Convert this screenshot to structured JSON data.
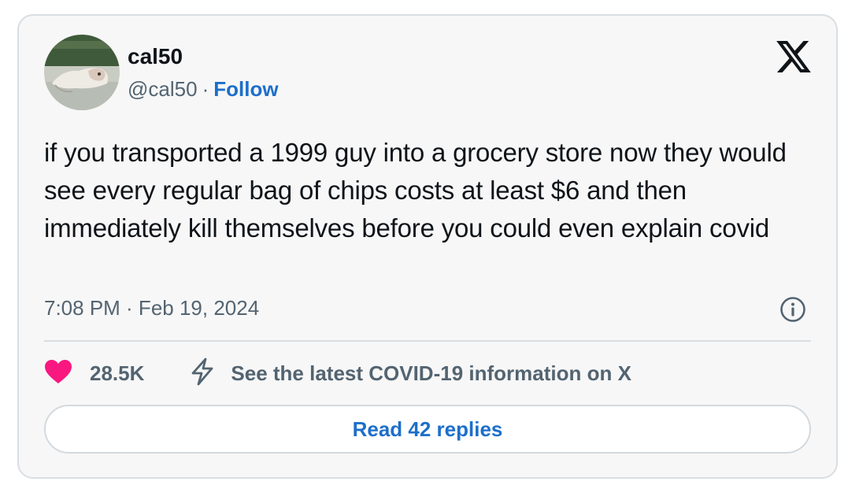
{
  "author": {
    "display_name": "cal50",
    "handle": "@cal50",
    "separator": "·",
    "follow_label": "Follow",
    "avatar_icon": "avatar-photo"
  },
  "tweet": {
    "text": "if you transported a 1999 guy into a grocery store now they would see every regular bag of chips costs at least $6 and then immediately kill themselves before you could even explain covid",
    "timestamp": "7:08 PM · Feb 19, 2024"
  },
  "actions": {
    "like_icon": "heart-icon",
    "like_count": "28.5K",
    "covid_icon": "lightning-icon",
    "covid_label": "See the latest COVID-19 information on X"
  },
  "replies_button": {
    "label": "Read 42 replies"
  },
  "icons": {
    "brand": "x-logo-icon",
    "info": "info-icon"
  },
  "colors": {
    "card_background": "#f7f7f7",
    "card_border": "#d9dee3",
    "text_primary": "#0f1419",
    "text_secondary": "#536471",
    "link": "#1d6fc9",
    "like": "#f91880"
  }
}
